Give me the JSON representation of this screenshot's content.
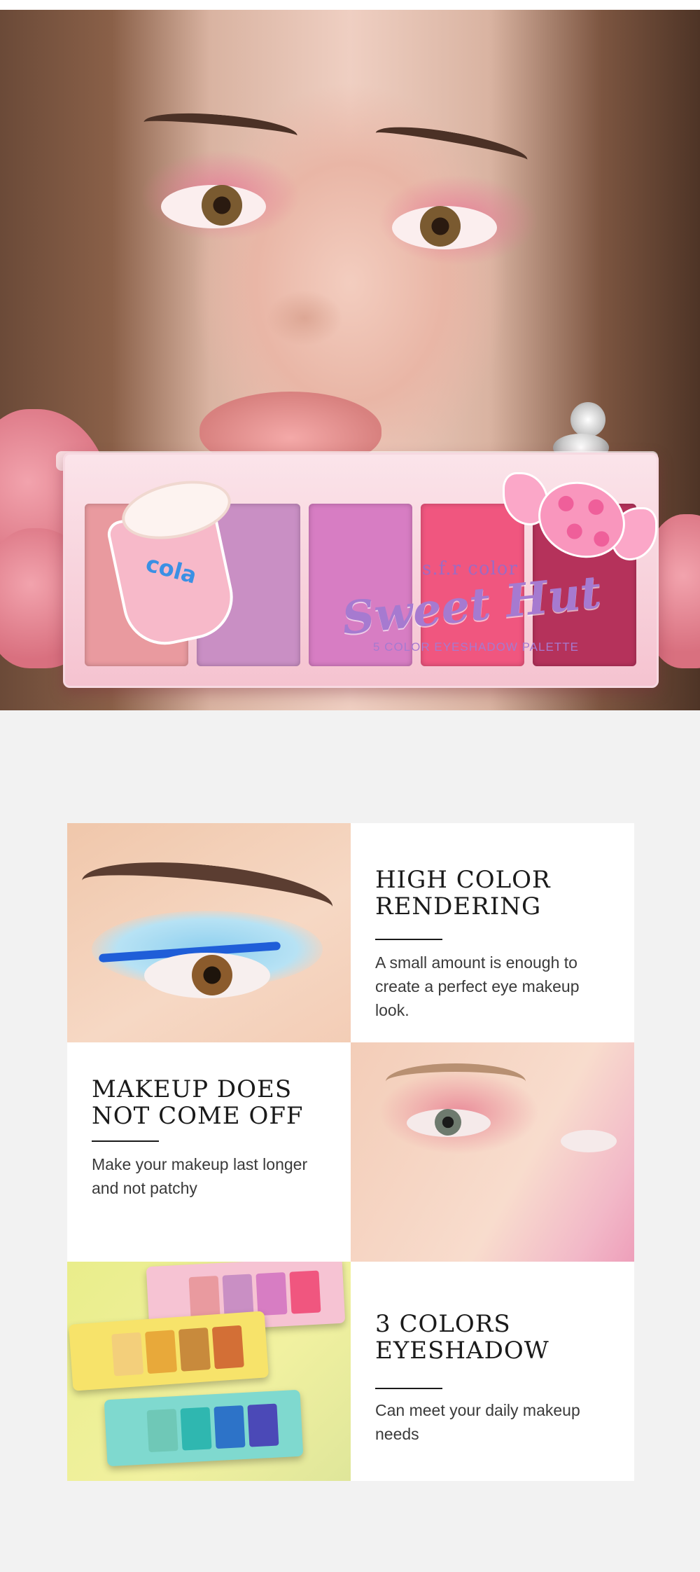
{
  "hero": {
    "palette": {
      "brand": "s.f.r color",
      "product_line": "Sweet Hut",
      "subtitle": "5 COLOR EYESHADOW PALETTE",
      "cup_label": "cola",
      "pan_colors": [
        "#e99a9f",
        "#c98fc4",
        "#d77dc3",
        "#f0567f",
        "#b5325b"
      ]
    }
  },
  "features": [
    {
      "title": "HIGH COLOR\nRENDERING",
      "description": "A small amount is enough to create a perfect eye makeup look."
    },
    {
      "title": "MAKEUP DOES\nNOT COME OFF",
      "description": "Make your makeup last longer and not patchy"
    },
    {
      "title": "3 COLORS\nEYESHADOW",
      "description": "Can meet your daily makeup needs"
    }
  ],
  "colors": {
    "background": "#f2f2f2",
    "card": "#ffffff",
    "heading": "#1a1a1a"
  }
}
